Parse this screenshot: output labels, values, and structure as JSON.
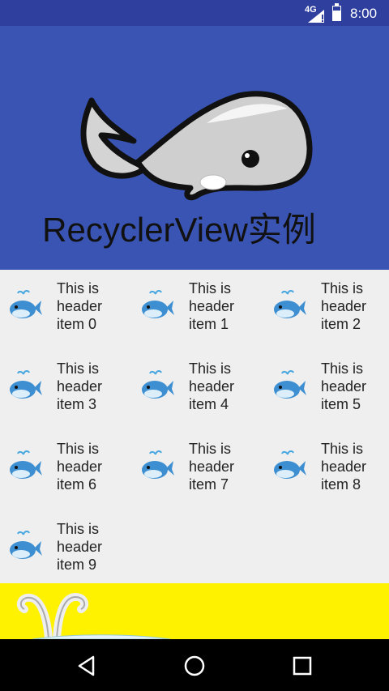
{
  "status_bar": {
    "network": "4G",
    "time": "8:00"
  },
  "header": {
    "title": "RecyclerView实例"
  },
  "grid": {
    "items": [
      {
        "label": "This is\nheader\nitem 0"
      },
      {
        "label": "This is\nheader\nitem 1"
      },
      {
        "label": "This is\nheader\nitem 2"
      },
      {
        "label": "This is\nheader\nitem 3"
      },
      {
        "label": "This is\nheader\nitem 4"
      },
      {
        "label": "This is\nheader\nitem 5"
      },
      {
        "label": "This is\nheader\nitem 6"
      },
      {
        "label": "This is\nheader\nitem 7"
      },
      {
        "label": "This is\nheader\nitem 8"
      },
      {
        "label": "This is\nheader\nitem 9"
      }
    ]
  },
  "colors": {
    "status_bar": "#2e3f9e",
    "header_bg": "#3a54b4",
    "list_bg": "#efefef",
    "banner": "#fff200",
    "nav_bar": "#000000"
  },
  "nav": {
    "icons": [
      "back-icon",
      "home-icon",
      "recents-icon"
    ]
  }
}
